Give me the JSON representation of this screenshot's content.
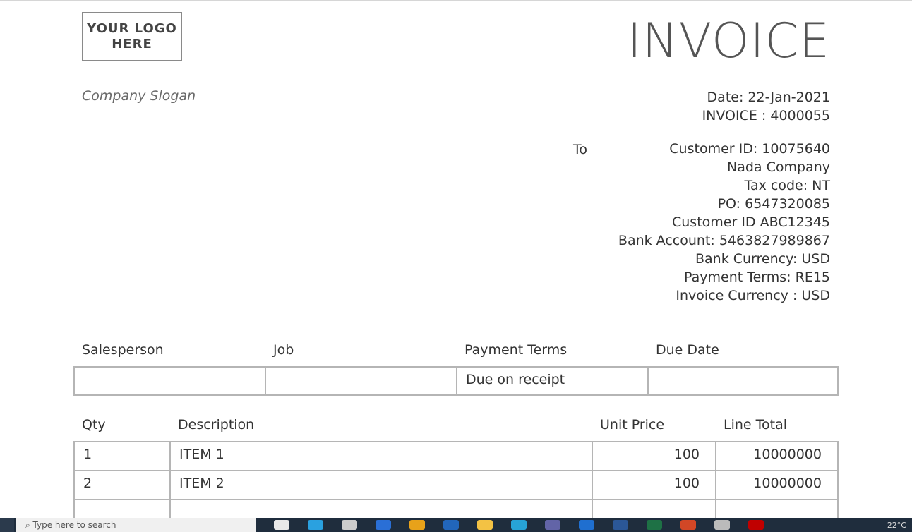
{
  "header": {
    "logo_text": "YOUR LOGO\nHERE",
    "title": "INVOICE",
    "slogan": "Company Slogan"
  },
  "meta": {
    "date": "Date: 22-Jan-2021",
    "invoice_no": "INVOICE : 4000055"
  },
  "bill_to": {
    "label": "To",
    "lines": [
      "Customer ID: 10075640",
      "Nada Company",
      "Tax code: NT",
      "PO: 6547320085",
      "Customer ID ABC12345",
      "Bank Account: 5463827989867",
      "Bank Currency: USD",
      "Payment Terms: RE15",
      "Invoice Currency : USD"
    ]
  },
  "sales_table": {
    "headers": [
      "Salesperson",
      "Job",
      "Payment Terms",
      "Due Date"
    ],
    "row": [
      "",
      "",
      "Due on receipt",
      ""
    ]
  },
  "items_table": {
    "headers": [
      "Qty",
      "Description",
      "Unit Price",
      "Line Total"
    ],
    "rows": [
      [
        "1",
        "ITEM 1",
        "100",
        "10000000"
      ],
      [
        "2",
        "ITEM 2",
        "100",
        "10000000"
      ],
      [
        "",
        "",
        "",
        ""
      ]
    ]
  },
  "taskbar": {
    "search_placeholder": "Type here to search",
    "tray_text": "22°C",
    "icon_colors": [
      "#e8e8e8",
      "#2aa1e0",
      "#cccccc",
      "#2a6fd6",
      "#e8a21a",
      "#2266bb",
      "#f3c244",
      "#27a3d6",
      "#6264a7",
      "#1f6fd0",
      "#2b5797",
      "#1e7145",
      "#d24726",
      "#bbbbbb",
      "#c00000"
    ]
  }
}
